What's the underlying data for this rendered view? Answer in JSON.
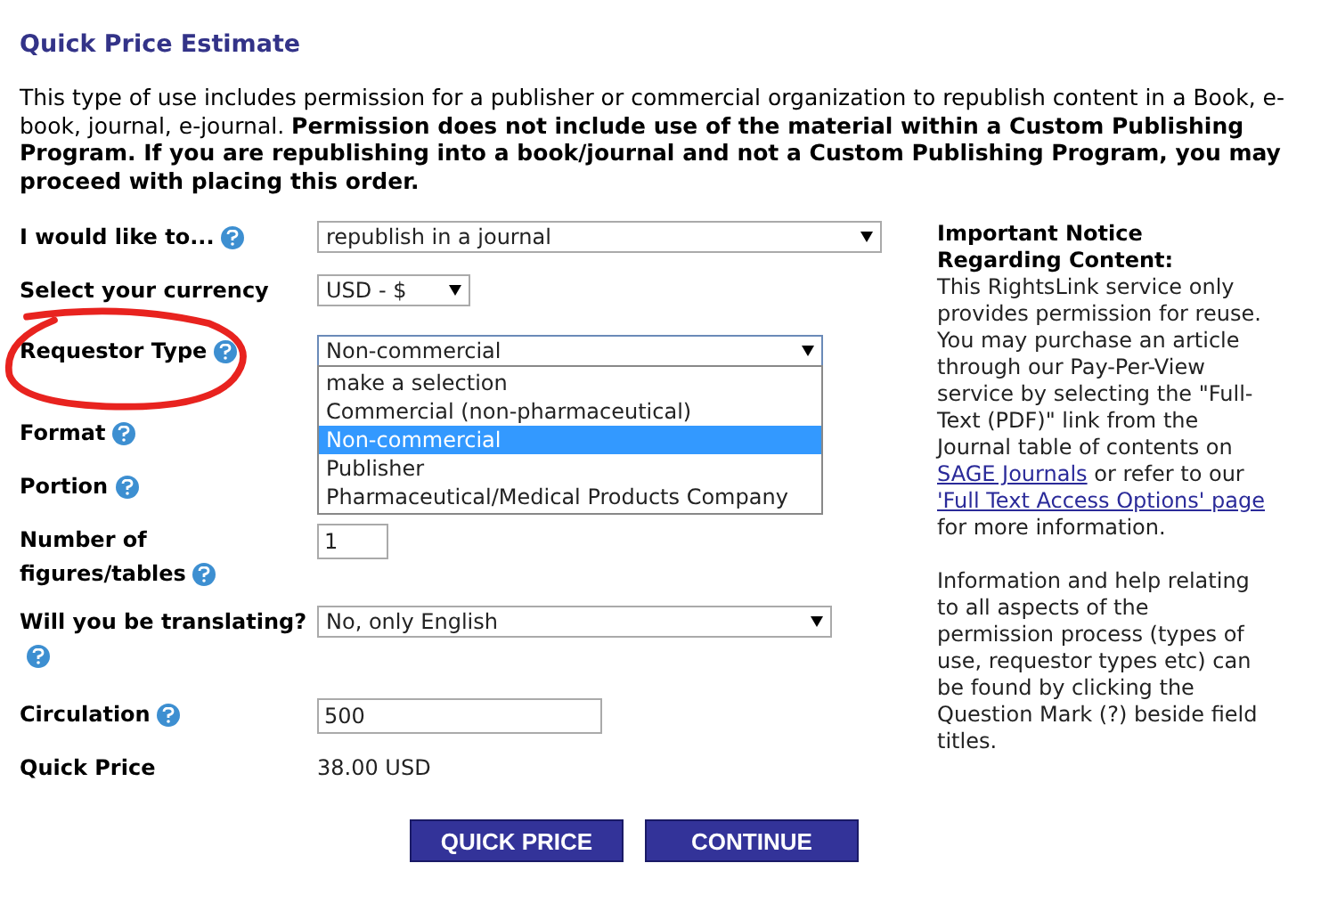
{
  "title": "Quick Price Estimate",
  "intro": "This type of use includes permission for a publisher or commercial organization to republish content in a Book, e-book, journal, e-journal. **Permission does not include use of the material within a Custom Publishing Program. If you are republishing into a book/journal and not a Custom Publishing Program, you may proceed with placing this order.**",
  "fields": [
    {
      "kind": "select",
      "label": "I would like to...",
      "help": true,
      "value": "republish in a journal"
    },
    {
      "kind": "select",
      "label": "Select your currency",
      "help": false,
      "value": "USD - $"
    },
    {
      "kind": "select",
      "label": "Requestor Type",
      "help": true,
      "value": "Non-commercial",
      "expanded": true,
      "options": [
        {
          "label": "make a selection",
          "selected": false
        },
        {
          "label": "Commercial (non-pharmaceutical)",
          "selected": false
        },
        {
          "label": "Non-commercial",
          "selected": true
        },
        {
          "label": "Publisher",
          "selected": false
        },
        {
          "label": "Pharmaceutical/Medical Products Company",
          "selected": false
        }
      ]
    },
    {
      "kind": "hidden",
      "label": "Format",
      "help": true
    },
    {
      "kind": "hidden",
      "label": "Portion",
      "help": true
    },
    {
      "kind": "input",
      "label": "Number of figures/tables",
      "help": true,
      "value": "1"
    },
    {
      "kind": "select",
      "label": "Will you be translating?",
      "help": true,
      "value": "No, only English"
    },
    {
      "kind": "input",
      "label": "Circulation",
      "help": true,
      "value": "500"
    },
    {
      "kind": "static",
      "label": "Quick Price",
      "help": false,
      "value": "38.00 USD"
    }
  ],
  "buttons": [
    "QUICK PRICE",
    "CONTINUE"
  ],
  "notice": {
    "heading": "Important Notice Regarding Content:",
    "body": [
      {
        "kind": "text",
        "text": "This RightsLink service only provides permission for reuse. You may purchase an article through our Pay-Per-View service by selecting the \"Full-Text (PDF)\" link from the Journal table of contents on "
      },
      {
        "kind": "link",
        "text": "SAGE Journals"
      },
      {
        "kind": "text",
        "text": " or refer to our "
      },
      {
        "kind": "link",
        "text": "'Full Text Access Options' page"
      },
      {
        "kind": "text",
        "text": " for more information."
      }
    ],
    "help": "Information and help relating to all aspects of the permission process (types of use, requestor types etc) can be found by clicking the Question Mark (?) beside field titles."
  }
}
